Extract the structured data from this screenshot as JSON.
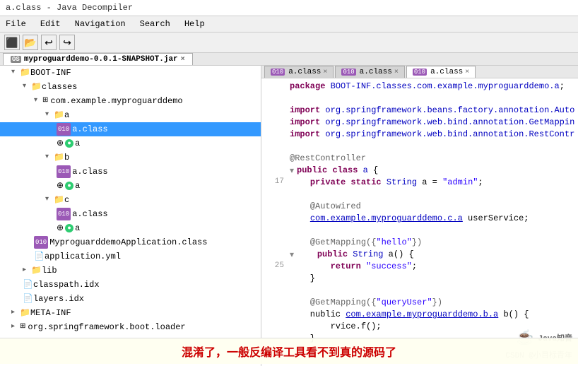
{
  "window": {
    "title": "a.class - Java Decompiler"
  },
  "menu": {
    "items": [
      "File",
      "Edit",
      "Navigation",
      "Search",
      "Help"
    ]
  },
  "file_tab": {
    "label": "myproguarddemo-0.0.1-SNAPSHOT.jar",
    "close": "×"
  },
  "editor_tabs": [
    {
      "label": "a.class",
      "badge": "010",
      "active": false,
      "close": "×"
    },
    {
      "label": "a.class",
      "badge": "010",
      "active": false,
      "close": "×"
    },
    {
      "label": "a.class",
      "badge": "010",
      "active": true,
      "close": "×"
    }
  ],
  "tree": {
    "root": "BOOT-INF",
    "items": [
      {
        "indent": 1,
        "label": "classes",
        "type": "folder",
        "expanded": true
      },
      {
        "indent": 2,
        "label": "com.example.myproguarddemo",
        "type": "package",
        "expanded": true
      },
      {
        "indent": 3,
        "label": "a",
        "type": "folder",
        "expanded": true
      },
      {
        "indent": 4,
        "label": "a.class",
        "type": "class",
        "selected": true
      },
      {
        "indent": 4,
        "label": "a",
        "type": "green-circle"
      },
      {
        "indent": 3,
        "label": "b",
        "type": "folder",
        "expanded": true
      },
      {
        "indent": 4,
        "label": "a.class",
        "type": "class"
      },
      {
        "indent": 4,
        "label": "a",
        "type": "green-circle"
      },
      {
        "indent": 3,
        "label": "c",
        "type": "folder",
        "expanded": true
      },
      {
        "indent": 4,
        "label": "a.class",
        "type": "class"
      },
      {
        "indent": 4,
        "label": "a",
        "type": "green-circle"
      },
      {
        "indent": 2,
        "label": "MyproguarddemoApplication.class",
        "type": "class"
      },
      {
        "indent": 2,
        "label": "application.yml",
        "type": "file"
      },
      {
        "indent": 1,
        "label": "lib",
        "type": "folder",
        "expanded": false
      },
      {
        "indent": 1,
        "label": "classpath.idx",
        "type": "file"
      },
      {
        "indent": 1,
        "label": "layers.idx",
        "type": "file"
      }
    ],
    "root2": "META-INF",
    "root3": "org.springframework.boot.loader"
  },
  "code": {
    "package_line": "package BOOT-INF.classes.com.example.myproguarddemo.a;",
    "imports": [
      "import org.springframework.beans.factory.annotation.Auto",
      "import org.springframework.web.bind.annotation.GetMappin",
      "import org.springframework.web.bind.annotation.RestContr"
    ],
    "annotation1": "@RestController",
    "class_decl": "public class a {",
    "line17": "    private static String a = \"admin\";",
    "annotation2": "@Autowired",
    "field": "    com.example.myproguarddemo.c.a userService;",
    "annotation3": "@GetMapping({\"hello\"})",
    "method1": "    public String a() {",
    "line25": "        return \"success\";",
    "closing1": "    }",
    "annotation4": "@GetMapping({\"queryUser\"})",
    "method2_comment": "    nublic com.example.myproguarddemo.b.a b() {",
    "method2_body": "        rvice.f();",
    "closing2": "    }"
  },
  "line_numbers": [
    17,
    25
  ],
  "banner": {
    "text": "混淆了，一般反编译工具看不到真的源码了"
  },
  "watermark": {
    "line1": "Java知音",
    "line2": "CSDN @小目标青年"
  }
}
